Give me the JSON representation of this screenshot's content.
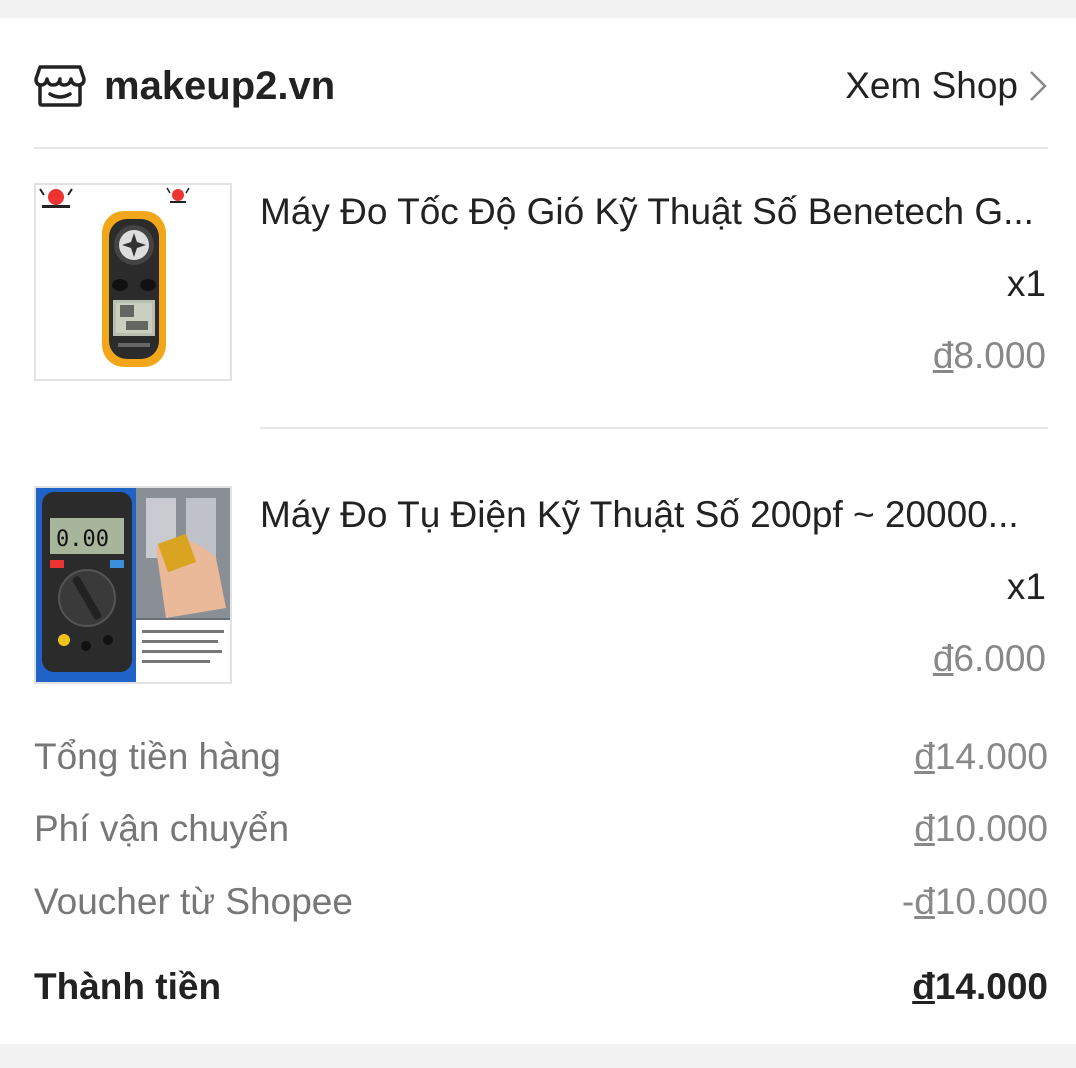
{
  "shop": {
    "name": "makeup2.vn",
    "view_shop_label": "Xem Shop",
    "icon": "store-icon"
  },
  "products": [
    {
      "title": "Máy Đo Tốc Độ Gió Kỹ Thuật Số Benetech G...",
      "quantity": "x1",
      "currency": "đ",
      "price": "8.000",
      "image": "anemometer-image"
    },
    {
      "title": "Máy Đo Tụ Điện Kỹ Thuật Số 200pf ~ 20000...",
      "quantity": "x1",
      "currency": "đ",
      "price": "6.000",
      "image": "capacitance-meter-image"
    }
  ],
  "summary": {
    "subtotal": {
      "label": "Tổng tiền hàng",
      "currency": "đ",
      "value": "14.000"
    },
    "shipping": {
      "label": "Phí vận chuyển",
      "currency": "đ",
      "value": "10.000"
    },
    "voucher": {
      "label": "Voucher từ Shopee",
      "prefix": "-",
      "currency": "đ",
      "value": "10.000"
    },
    "total": {
      "label": "Thành tiền",
      "currency": "đ",
      "value": "14.000"
    }
  },
  "colors": {
    "background": "#f2f2f2",
    "card": "#ffffff",
    "text": "#222222",
    "muted": "#888888"
  }
}
